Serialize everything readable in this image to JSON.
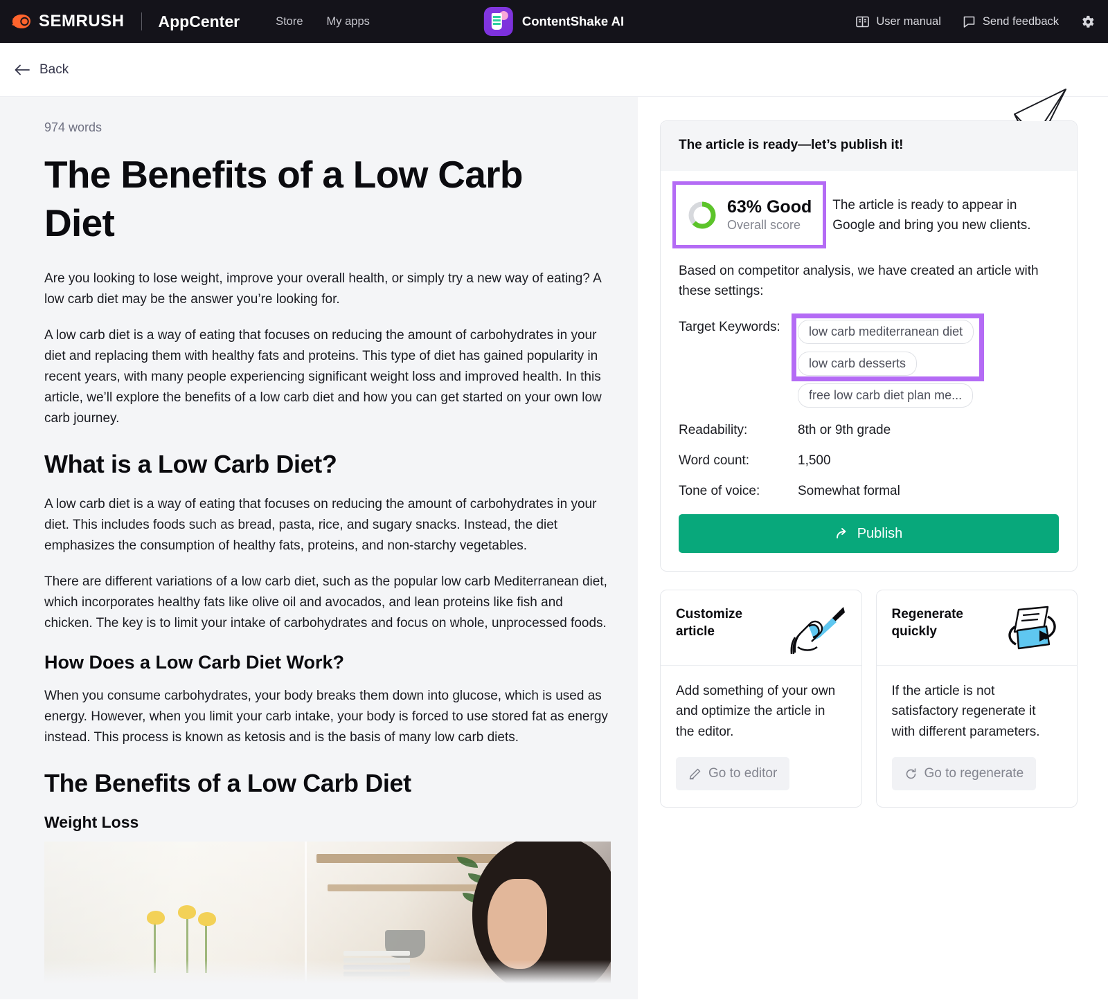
{
  "topnav": {
    "brand": "SEMRUSH",
    "brand_sub": "AppCenter",
    "links": [
      {
        "label": "Store"
      },
      {
        "label": "My apps"
      }
    ],
    "app_name": "ContentShake AI",
    "right_items": [
      {
        "label": "User manual",
        "icon": "book-icon"
      },
      {
        "label": "Send feedback",
        "icon": "feedback-icon"
      }
    ],
    "settings_icon": "gear-icon"
  },
  "backbar": {
    "label": "Back",
    "icon": "arrow-left-icon"
  },
  "article": {
    "word_count": "974 words",
    "title": "The Benefits of a Low Carb Diet",
    "blocks": [
      {
        "type": "p",
        "text": "Are you looking to lose weight, improve your overall health, or simply try a new way of eating? A low carb diet may be the answer you’re looking for."
      },
      {
        "type": "p",
        "text": "A low carb diet is a way of eating that focuses on reducing the amount of carbohydrates in your diet and replacing them with healthy fats and proteins. This type of diet has gained popularity in recent years, with many people experiencing significant weight loss and improved health. In this article, we’ll explore the benefits of a low carb diet and how you can get started on your own low carb journey."
      },
      {
        "type": "h2",
        "text": "What is a Low Carb Diet?"
      },
      {
        "type": "p",
        "text": "A low carb diet is a way of eating that focuses on reducing the amount of carbohydrates in your diet. This includes foods such as bread, pasta, rice, and sugary snacks. Instead, the diet emphasizes the consumption of healthy fats, proteins, and non-starchy vegetables."
      },
      {
        "type": "p",
        "text": "There are different variations of a low carb diet, such as the popular low carb Mediterranean diet, which incorporates healthy fats like olive oil and avocados, and lean proteins like fish and chicken. The key is to limit your intake of carbohydrates and focus on whole, unprocessed foods."
      },
      {
        "type": "h3",
        "text": "How Does a Low Carb Diet Work?"
      },
      {
        "type": "p",
        "text": "When you consume carbohydrates, your body breaks them down into glucose, which is used as energy. However, when you limit your carb intake, your body is forced to use stored fat as energy instead. This process is known as ketosis and is the basis of many low carb diets."
      },
      {
        "type": "h2",
        "text": "The Benefits of a Low Carb Diet"
      },
      {
        "type": "h4",
        "text": "Weight Loss"
      },
      {
        "type": "image",
        "text": "kitchen window with daffodils and woman"
      }
    ]
  },
  "sidebar": {
    "ready_card": {
      "header": "The article is ready—let’s publish it!",
      "score_value": "63% Good",
      "score_label": "Overall score",
      "score_percent": 63,
      "score_color": "#5cc42a",
      "score_track_color": "#d7d9dd",
      "score_description": "The article is ready to appear in Google and bring you new clients.",
      "based_on_text": "Based on competitor analysis, we have created an article with these settings:",
      "keywords_label": "Target Keywords:",
      "keywords": [
        "low carb mediterranean diet",
        "low carb desserts",
        "free low carb diet plan me..."
      ],
      "settings": [
        {
          "label": "Readability:",
          "value": "8th or 9th grade"
        },
        {
          "label": "Word count:",
          "value": "1,500"
        },
        {
          "label": "Tone of voice:",
          "value": "Somewhat formal"
        }
      ],
      "publish_label": "Publish",
      "publish_icon": "share-arrow-icon",
      "publish_color": "#08a87b",
      "highlight_color": "#b46bf5"
    },
    "mini_cards": [
      {
        "title": "Customize article",
        "description": "Add something of your own and optimize the article in the editor.",
        "button_label": "Go to editor",
        "button_icon": "pencil-icon",
        "art": "hand-holding-pencil"
      },
      {
        "title": "Regenerate quickly",
        "description": "If the article is not satisfactory regenerate it with different parameters.",
        "button_label": "Go to regenerate",
        "button_icon": "refresh-icon",
        "art": "paper-refresh"
      }
    ]
  }
}
